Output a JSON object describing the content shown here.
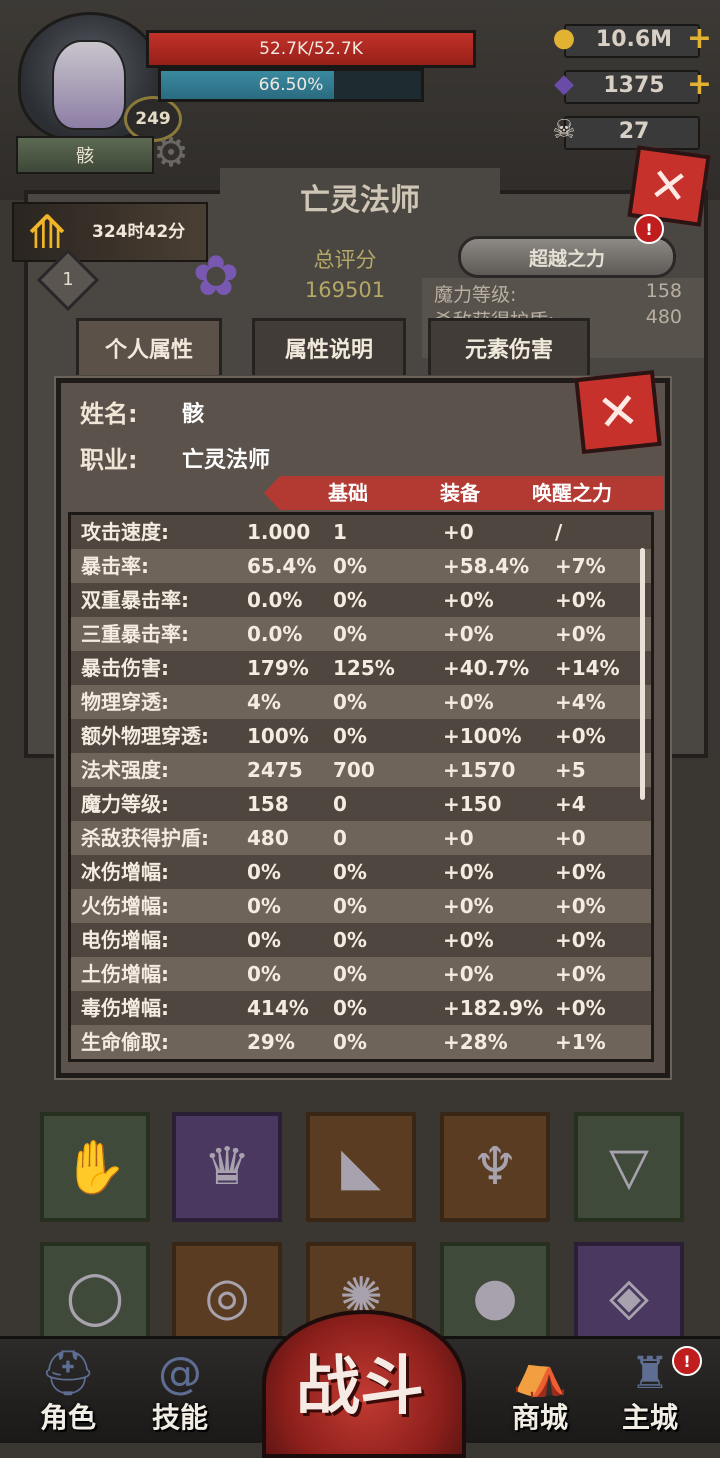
{
  "player": {
    "level": "249",
    "name": "骸",
    "hp_text": "52.7K/52.7K",
    "hp_fraction": 1.0,
    "xp_text": "66.50%",
    "xp_fraction": 0.665
  },
  "resources": {
    "gold": "10.6M",
    "crystals": "1375",
    "skulls": "27",
    "plus": "+"
  },
  "panel": {
    "title": "亡灵法师",
    "close_glyph": "✕",
    "timer": "324时42分",
    "rank": "1",
    "score_label": "总评分",
    "score_value": "169501",
    "transcend_label": "超越之力",
    "alert": "!",
    "side_line1_label": "魔力等级:",
    "side_line1_value": "158",
    "side_line2_label": "杀敌获得护盾:",
    "side_line2_value": "480"
  },
  "tabs": [
    {
      "label": "个人属性"
    },
    {
      "label": "属性说明"
    },
    {
      "label": "元素伤害"
    }
  ],
  "modal": {
    "name_label": "姓名:",
    "name_value": "骸",
    "class_label": "职业:",
    "class_value": "亡灵法师",
    "close_glyph": "✕",
    "headers": {
      "base": "基础",
      "equip": "装备",
      "awaken": "唤醒之力"
    },
    "rows": [
      [
        "攻击速度:",
        "1.000",
        "1",
        "+0",
        "/"
      ],
      [
        "暴击率:",
        "65.4%",
        "0%",
        "+58.4%",
        "+7%"
      ],
      [
        "双重暴击率:",
        "0.0%",
        "0%",
        "+0%",
        "+0%"
      ],
      [
        "三重暴击率:",
        "0.0%",
        "0%",
        "+0%",
        "+0%"
      ],
      [
        "暴击伤害:",
        "179%",
        "125%",
        "+40.7%",
        "+14%"
      ],
      [
        "物理穿透:",
        "4%",
        "0%",
        "+0%",
        "+4%"
      ],
      [
        "额外物理穿透:",
        "100%",
        "0%",
        "+100%",
        "+0%"
      ],
      [
        "法术强度:",
        "2475",
        "700",
        "+1570",
        "+5"
      ],
      [
        "魔力等级:",
        "158",
        "0",
        "+150",
        "+4"
      ],
      [
        "杀敌获得护盾:",
        "480",
        "0",
        "+0",
        "+0"
      ],
      [
        "冰伤增幅:",
        "0%",
        "0%",
        "+0%",
        "+0%"
      ],
      [
        "火伤增幅:",
        "0%",
        "0%",
        "+0%",
        "+0%"
      ],
      [
        "电伤增幅:",
        "0%",
        "0%",
        "+0%",
        "+0%"
      ],
      [
        "土伤增幅:",
        "0%",
        "0%",
        "+0%",
        "+0%"
      ],
      [
        "毒伤增幅:",
        "414%",
        "0%",
        "+182.9%",
        "+0%"
      ],
      [
        "生命偷取:",
        "29%",
        "0%",
        "+28%",
        "+1%"
      ]
    ]
  },
  "equipment": [
    {
      "icon": "gauntlet-icon",
      "rarity": "green"
    },
    {
      "icon": "spiked-armor-icon",
      "rarity": "purple"
    },
    {
      "icon": "boots-icon",
      "rarity": "orange"
    },
    {
      "icon": "amulet-icon",
      "rarity": "orange"
    },
    {
      "icon": "pendant-icon",
      "rarity": "green"
    },
    {
      "icon": "dragon-ring-icon",
      "rarity": "green"
    },
    {
      "icon": "twisted-ring-icon",
      "rarity": "orange"
    },
    {
      "icon": "spiked-ring-icon",
      "rarity": "orange"
    },
    {
      "icon": "ruby-ring-icon",
      "rarity": "green"
    },
    {
      "icon": "gem-ring-icon",
      "rarity": "purple"
    }
  ],
  "nav": {
    "role": "角色",
    "skills": "技能",
    "battle": "战斗",
    "shop": "商城",
    "city": "主城",
    "alert": "!"
  },
  "colors": {
    "hp": "#c2322a",
    "xp": "#3a8aa0",
    "accent_red": "#b33a33",
    "gold": "#e2b233"
  }
}
